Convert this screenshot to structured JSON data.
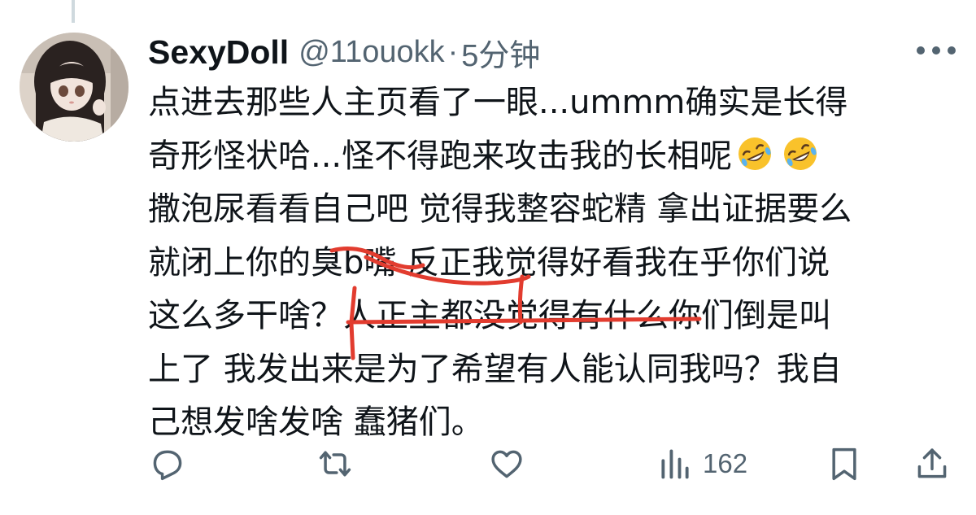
{
  "tweet": {
    "display_name": "SexyDoll",
    "handle": "@11ouokk",
    "separator": "·",
    "time": "5分钟",
    "lines": [
      "点进去那些人主页看了一眼...ummm确实是长得",
      "奇形怪状哈...怪不得跑来攻击我的长相呢",
      "撒泡尿看看自己吧 觉得我整容蛇精 拿出证据要么",
      "就闭上你的臭b嘴 反正我觉得好看我在乎你们说",
      "这么多干啥？人正主都没觉得有什么你们倒是叫",
      "上了 我发出来是为了希望有人能认同我吗？我自",
      "己想发啥发啥 蠢猪们。"
    ],
    "emoji": "rolling-on-floor-laughing",
    "emoji_count": 2
  },
  "actions": {
    "reply_icon": "reply-icon",
    "retweet_icon": "retweet-icon",
    "like_icon": "like-icon",
    "views_icon": "views-icon",
    "views_count": "162",
    "bookmark_icon": "bookmark-icon",
    "share_icon": "share-icon"
  },
  "colors": {
    "text": "#0f1419",
    "secondary": "#536471",
    "annotation": "#e23c2f"
  }
}
